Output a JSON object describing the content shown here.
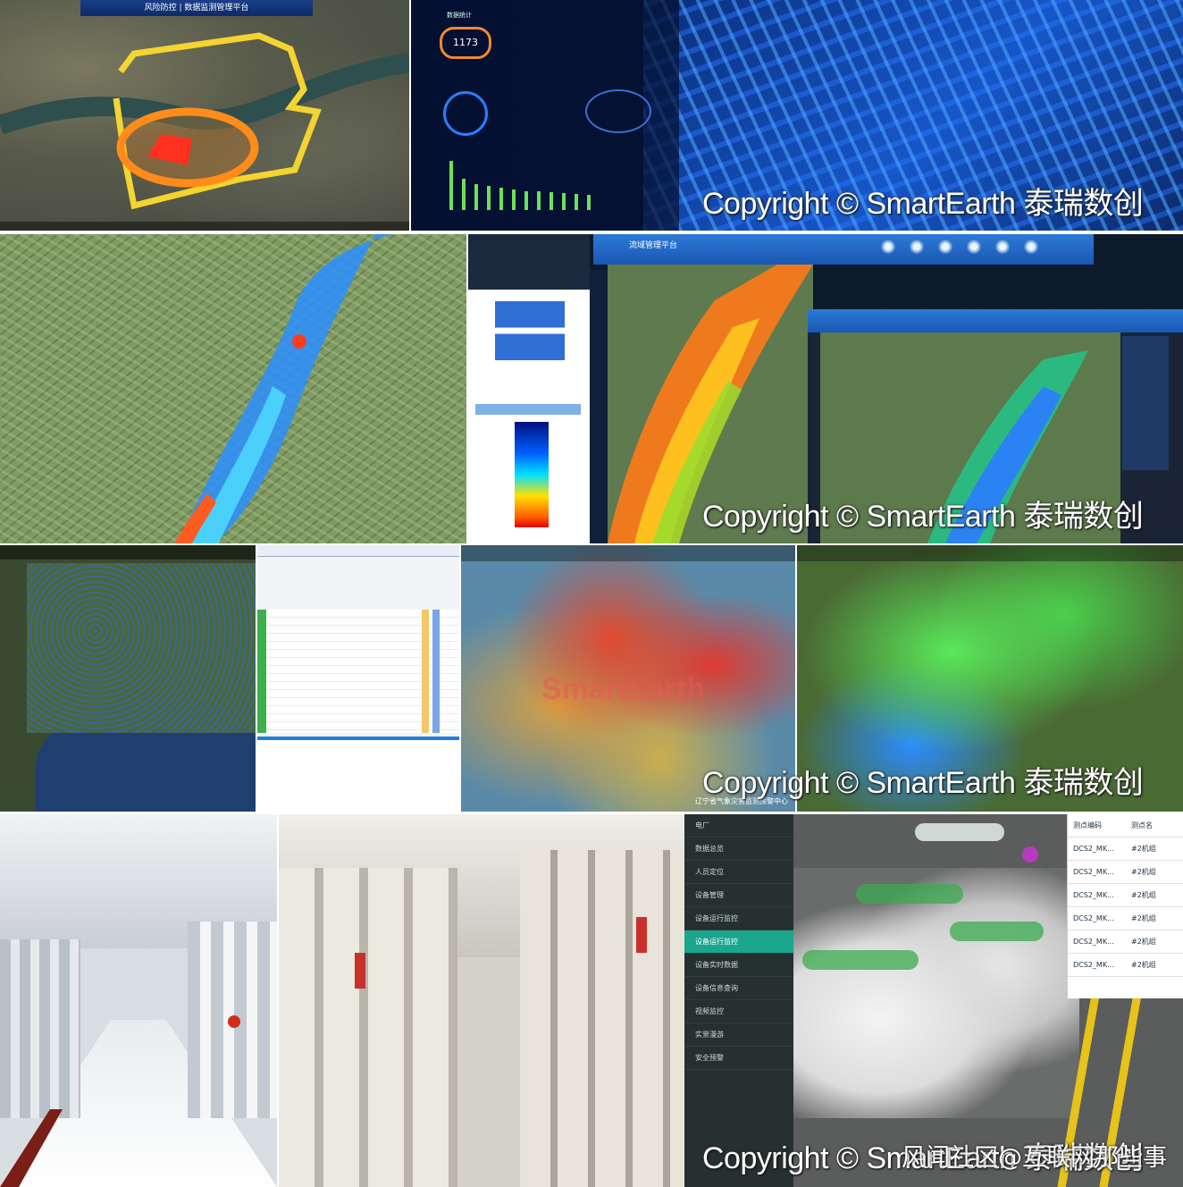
{
  "copyright_text": "Copyright © SmartEarth 泰瑞数创",
  "weibo_watermark": "风闻社区@互联网那些事",
  "panel1": {
    "header_title": "风险防控",
    "header_sub": "数据监测管理平台"
  },
  "panel2": {
    "counter_value": "1173",
    "label": "数据统计"
  },
  "panel4_header": "流域管理平台",
  "panel9": {
    "menu_items": [
      "电厂",
      "数据总览",
      "人员定位",
      "设备管理",
      "设备运行监控",
      "设备运行监控",
      "设备实时数据",
      "设备信息查询",
      "视频监控",
      "实景漫游",
      "安全预警"
    ],
    "active_index": 5,
    "table_headers": [
      "测点编码",
      "测点名"
    ],
    "table_rows": [
      "DCS2_MK...",
      "DCS2_MK...",
      "DCS2_MK...",
      "DCS2_MK...",
      "DCS2_MK...",
      "DCS2_MK..."
    ],
    "table_tag": "#2机组"
  },
  "panel6_footer": "辽宁省气象灾害监测预警中心",
  "panel7_logo": "SmartEarth",
  "colors": {
    "accent_teal": "#1aa58d",
    "dashboard_blue": "#0a1f4a",
    "header_blue": "#1e5db5"
  }
}
